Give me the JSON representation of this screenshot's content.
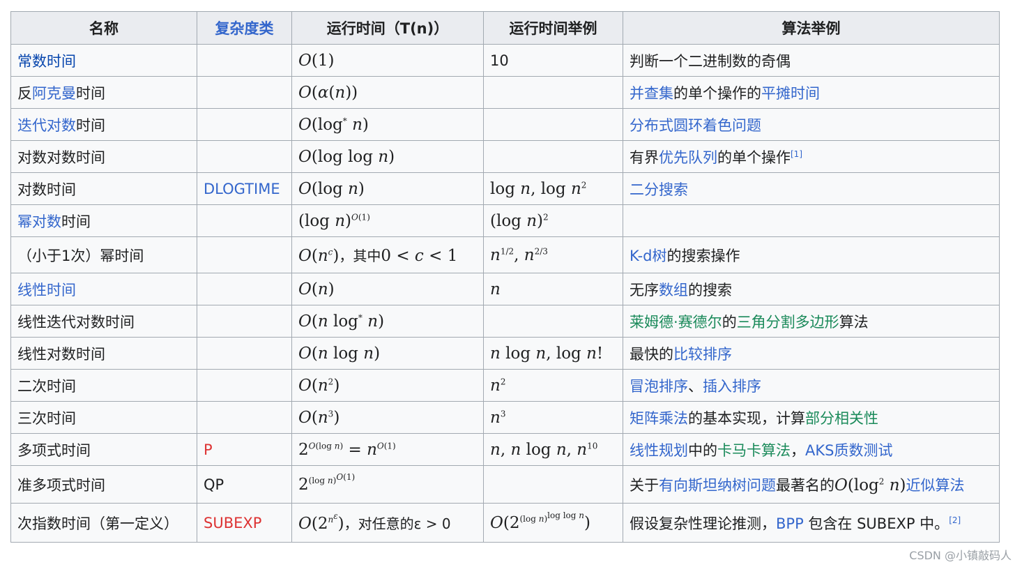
{
  "header": {
    "col_name": "名称",
    "col_class": "复杂度类",
    "col_time": "运行时间（T(n)）",
    "col_examples": "运行时间举例",
    "col_algos": "算法举例"
  },
  "rows": [
    {
      "name": "常数时间",
      "class": "",
      "time": "O(1)",
      "examples": "10",
      "algos": "判断一个二进制数的奇偶"
    },
    {
      "name": "反阿克曼时间",
      "class": "",
      "time": "O(α(n))",
      "examples": "",
      "algos": "并查集的单个操作的平摊时间"
    },
    {
      "name": "迭代对数时间",
      "class": "",
      "time": "O(log* n)",
      "examples": "",
      "algos": "分布式圆环着色问题"
    },
    {
      "name": "对数对数时间",
      "class": "",
      "time": "O(log log n)",
      "examples": "",
      "algos": "有界优先队列的单个操作[1]"
    },
    {
      "name": "对数时间",
      "class": "DLOGTIME",
      "time": "O(log n)",
      "examples": "log n，log n²",
      "algos": "二分搜索"
    },
    {
      "name": "幂对数时间",
      "class": "",
      "time": "(log n)^O(1)",
      "examples": "(log n)²",
      "algos": ""
    },
    {
      "name": "（小于1次）幂时间",
      "class": "",
      "time": "O(n^c)，其中0 < c < 1",
      "examples": "n^½，n^⅔",
      "algos": "K-d树的搜索操作"
    },
    {
      "name": "线性时间",
      "class": "",
      "time": "O(n)",
      "examples": "n",
      "algos": "无序数组的搜索"
    },
    {
      "name": "线性迭代对数时间",
      "class": "",
      "time": "O(n log* n)",
      "examples": "",
      "algos": "莱姆德·赛德尔的三角分割多边形算法"
    },
    {
      "name": "线性对数时间",
      "class": "",
      "time": "O(n log n)",
      "examples": "n log n，log n!",
      "algos": "最快的比较排序"
    },
    {
      "name": "二次时间",
      "class": "",
      "time": "O(n²)",
      "examples": "n²",
      "algos": "冒泡排序、插入排序"
    },
    {
      "name": "三次时间",
      "class": "",
      "time": "O(n³)",
      "examples": "n³",
      "algos": "矩阵乘法的基本实现，计算部分相关性"
    },
    {
      "name": "多项式时间",
      "class": "P",
      "time": "2^O(log n) = n^O(1)",
      "examples": "n，n log n，n^10",
      "algos": "线性规划中的卡马卡算法，AKS质数测试"
    },
    {
      "name": "准多项式时间",
      "class": "QP",
      "time": "2^(log n)^O(1)",
      "examples": "",
      "algos": "关于有向斯坦纳树问题最著名的O(log² n)近似算法"
    },
    {
      "name": "次指数时间（第一定义）",
      "class": "SUBEXP",
      "time": "O(2^n^ε)，对任意的ε > 0",
      "examples": "O(2^(log n)^log log n)",
      "algos": "假设复杂性理论推测，BPP 包含在 SUBEXP 中。[2]"
    }
  ],
  "watermark": "CSDN @小镇敲码人",
  "colors": {
    "link": "#3366cc",
    "visited": "#0645ad",
    "green_link": "#1a8a5a",
    "red_class": "#d33",
    "header_bg": "#eaecf0",
    "cell_bg": "#f8f9fa",
    "border": "#a2a9b1"
  }
}
